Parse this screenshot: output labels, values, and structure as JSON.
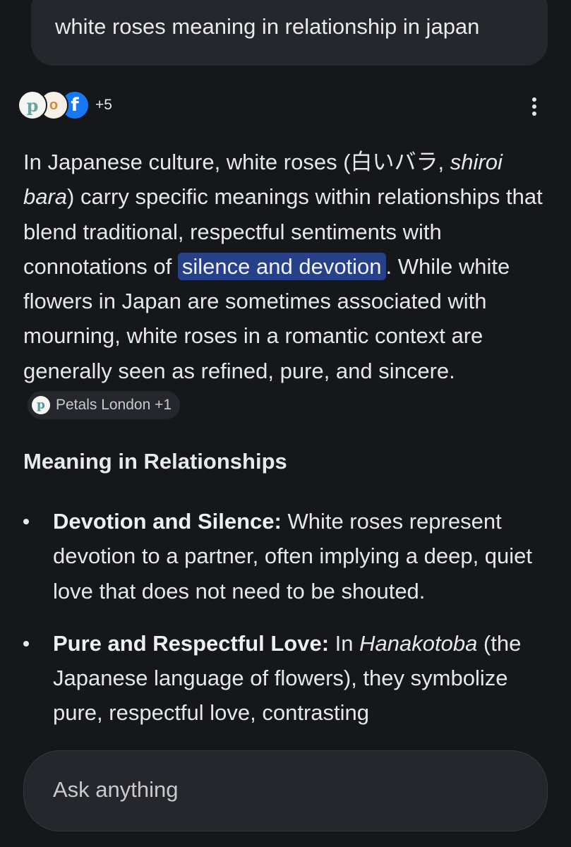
{
  "query": {
    "text": "white roses meaning in relationship in japan"
  },
  "sources": {
    "icons": [
      "petals-london-icon",
      "o-site-icon",
      "facebook-icon"
    ],
    "icon_glyphs": [
      "p",
      "o",
      "f"
    ],
    "extra_count": "+5"
  },
  "answer": {
    "p1": "In Japanese culture, white roses (白いバラ, ",
    "p1_italic": "shiroi bara",
    "p2": ") carry specific meanings within relationships that blend traditional, respectful sentiments with connotations of ",
    "highlight": "silence and devotion",
    "p3": ". While white flowers in Japan are sometimes associated with mourning, white roses in a romantic context are generally seen as refined, pure, and sincere.",
    "citation": {
      "label": "Petals London +1",
      "favicon_glyph": "p"
    }
  },
  "section": {
    "heading": "Meaning in Relationships",
    "bullets": [
      {
        "title": "Devotion and Silence:",
        "text": " White roses represent devotion to a partner, often implying a deep, quiet love that does not need to be shouted."
      },
      {
        "title": "Pure and Respectful Love:",
        "text_before": " In ",
        "italic": "Hanakotoba",
        "text_after": " (the Japanese language of flowers), they symbolize pure, respectful love, contrasting"
      }
    ]
  },
  "ask_bar": {
    "placeholder": "Ask anything"
  },
  "colors": {
    "background": "#16171b",
    "surface": "#26272c",
    "highlight": "#26408a",
    "facebook_blue": "#1877f2"
  }
}
